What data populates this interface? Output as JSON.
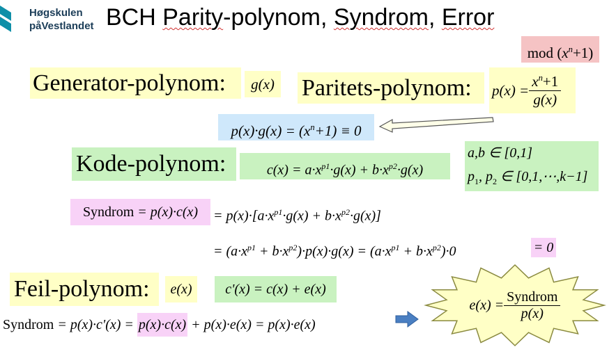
{
  "logo": {
    "line1": "Høgskulen",
    "line2": "påVestlandet",
    "color": "#0f8fa8"
  },
  "slide": {
    "title_plain1": "BCH ",
    "title_wavy1": "Parity",
    "title_plain2": "-polynom, ",
    "title_wavy2": "Syndrom",
    "title_plain3": ", ",
    "title_wavy3": "Error"
  },
  "mod": {
    "text": "mod",
    "x": "x",
    "n": "n",
    "rest": "+1)"
  },
  "generator": {
    "label": "Generator-polynom:",
    "expr": "g(x)"
  },
  "parity": {
    "label": "Paritets-polynom:",
    "lhs": "p(x) =",
    "num_x": "x",
    "num_n": "n",
    "num_rest": "+1",
    "den": "g(x)"
  },
  "identity": {
    "text1": "p(x)·g(x) = (x",
    "n": "n",
    "text2": "+1) ≡ 0"
  },
  "code": {
    "label": "Kode-polynom:",
    "expr_a": "c(x) = a·x",
    "sup1": "p1",
    "expr_b": "·g(x) + b·x",
    "sup2": "p2",
    "expr_c": "·g(x)"
  },
  "sets": {
    "line1": "a,b ∈ [0,1]",
    "line2_a": "p",
    "sub1": "1",
    "line2_b": ", p",
    "sub2": "2",
    "line2_c": " ∈ [0,1,⋯,k−1]"
  },
  "syndrome1": {
    "label": "Syndrom",
    "rhs_highlight": "= p(x)·c(x)",
    "rest_a": "= p(x)·[a·x",
    "sup1": "p1",
    "rest_b": "·g(x) + b·x",
    "sup2": "p2",
    "rest_c": "·g(x)]"
  },
  "syndrome2": {
    "part_a": "= (a·x",
    "sup1": "p1",
    "part_b": " + b·x",
    "sup2": "p2",
    "part_c": ")·p(x)·g(x) = (a·x",
    "sup3": "p1",
    "part_d": " + b·x",
    "sup4": "p2",
    "part_e": ")·0",
    "result": "= 0"
  },
  "error": {
    "label": "Feil-polynom:",
    "expr": "e(x)",
    "received": "c'(x) = c(x) + e(x)"
  },
  "syndrome3": {
    "label": "Syndrom",
    "part_a": "= p(x)·c'(x) =",
    "highlight": "p(x)·c(x)",
    "part_b": "+ p(x)·e(x) = p(x)·e(x)"
  },
  "result_burst": {
    "lhs": "e(x) =",
    "num": "Syndrom",
    "den": "p(x)",
    "fill": "#ffffc6",
    "stroke": "#8a8a40"
  }
}
